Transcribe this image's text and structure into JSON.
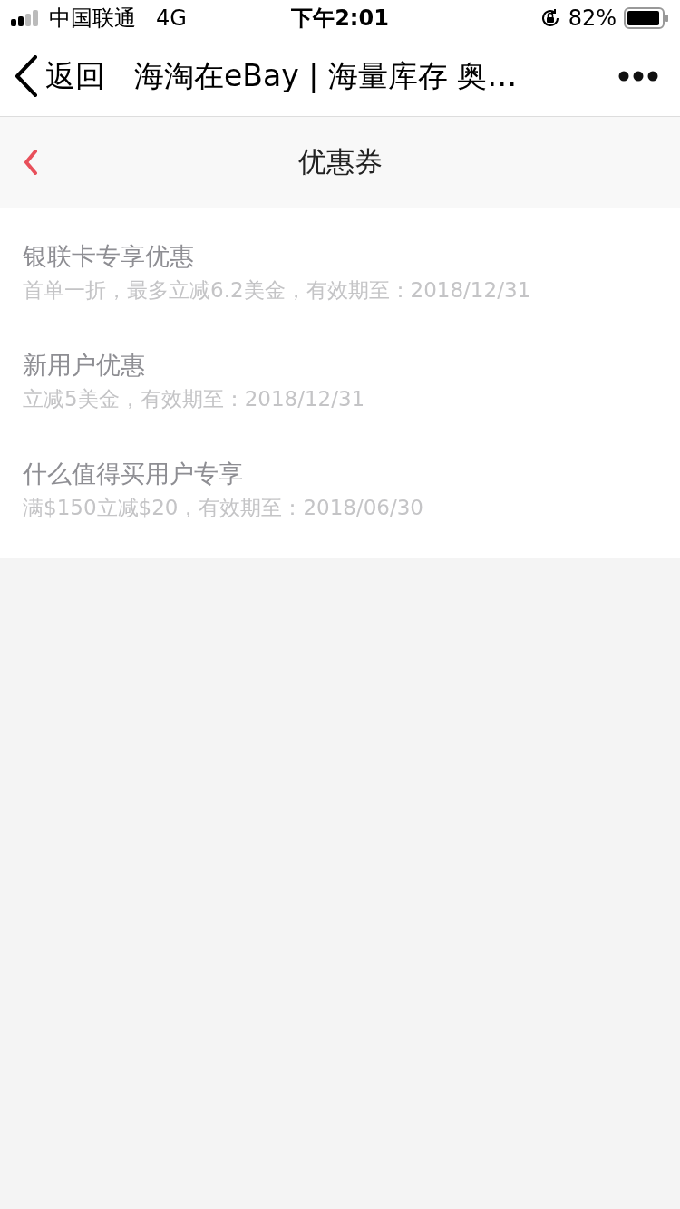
{
  "status_bar": {
    "carrier": "中国联通",
    "network": "4G",
    "time": "下午2:01",
    "battery": "82%"
  },
  "nav_bar": {
    "back_label": "返回",
    "title": "海淘在eBay | 海量库存 奥…"
  },
  "page_header": {
    "title": "优惠券"
  },
  "coupons": [
    {
      "title": "银联卡专享优惠",
      "detail": "首单一折，最多立减6.2美金，有效期至：2018/12/31"
    },
    {
      "title": "新用户优惠",
      "detail": "立减5美金，有效期至：2018/12/31"
    },
    {
      "title": "什么值得买用户专享",
      "detail": "满$150立减$20，有效期至：2018/06/30"
    }
  ]
}
